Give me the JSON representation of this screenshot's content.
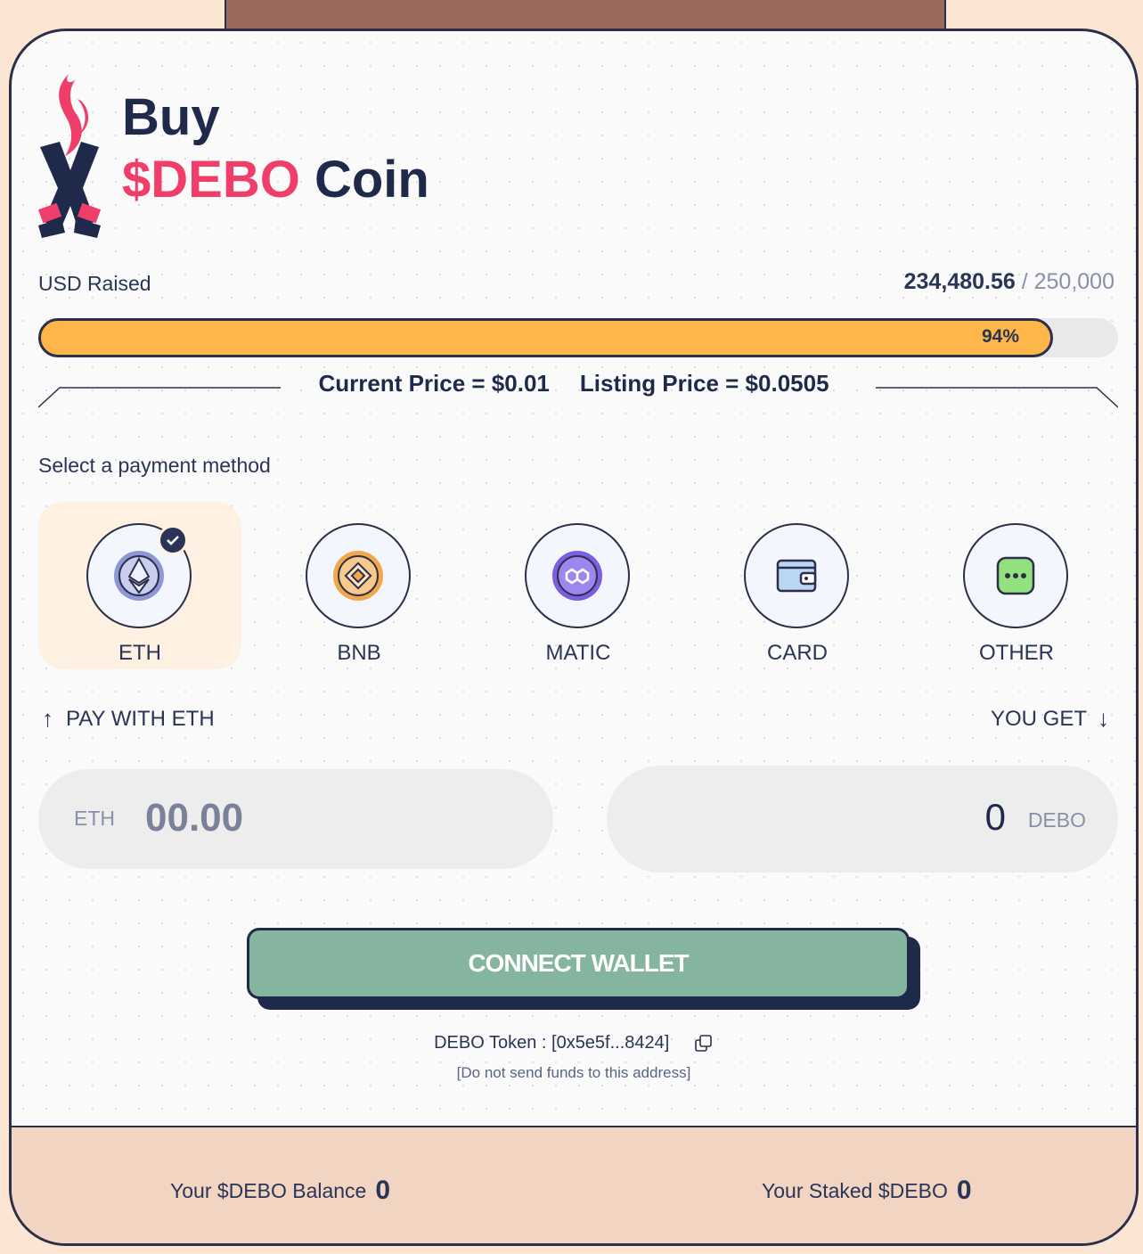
{
  "header": {
    "title_line1": "Buy",
    "title_token": "$DEBO",
    "title_coin": "Coin"
  },
  "raised": {
    "label": "USD Raised",
    "current": "234,480.56",
    "separator": " / ",
    "target": "250,000",
    "progress_percent": 94,
    "progress_label": "94%"
  },
  "prices": {
    "current": "Current Price = $0.01",
    "listing": "Listing Price =  $0.0505"
  },
  "payment": {
    "label": "Select a payment method",
    "selected": "ETH",
    "methods": [
      {
        "label": "ETH",
        "icon": "eth-icon"
      },
      {
        "label": "BNB",
        "icon": "bnb-icon"
      },
      {
        "label": "MATIC",
        "icon": "matic-icon"
      },
      {
        "label": "CARD",
        "icon": "wallet-card-icon"
      },
      {
        "label": "OTHER",
        "icon": "more-icon"
      }
    ]
  },
  "exchange": {
    "pay_label": "PAY WITH ETH",
    "get_label": "YOU GET",
    "pay_currency": "ETH",
    "pay_placeholder": "00.00",
    "get_amount": "0",
    "get_unit": "DEBO"
  },
  "actions": {
    "connect_label": "CONNECT WALLET"
  },
  "token": {
    "address_text": "DEBO Token : [0x5e5f...8424]",
    "note": "[Do not send funds to this address]"
  },
  "footer": {
    "balance_label": "Your $DEBO Balance",
    "balance_value": "0",
    "staked_label": "Your Staked $DEBO",
    "staked_value": "0"
  },
  "colors": {
    "accent_pink": "#ef3e6a",
    "progress_orange": "#fdb649",
    "connect_green": "#85b59f",
    "navy": "#1f2a4a"
  }
}
